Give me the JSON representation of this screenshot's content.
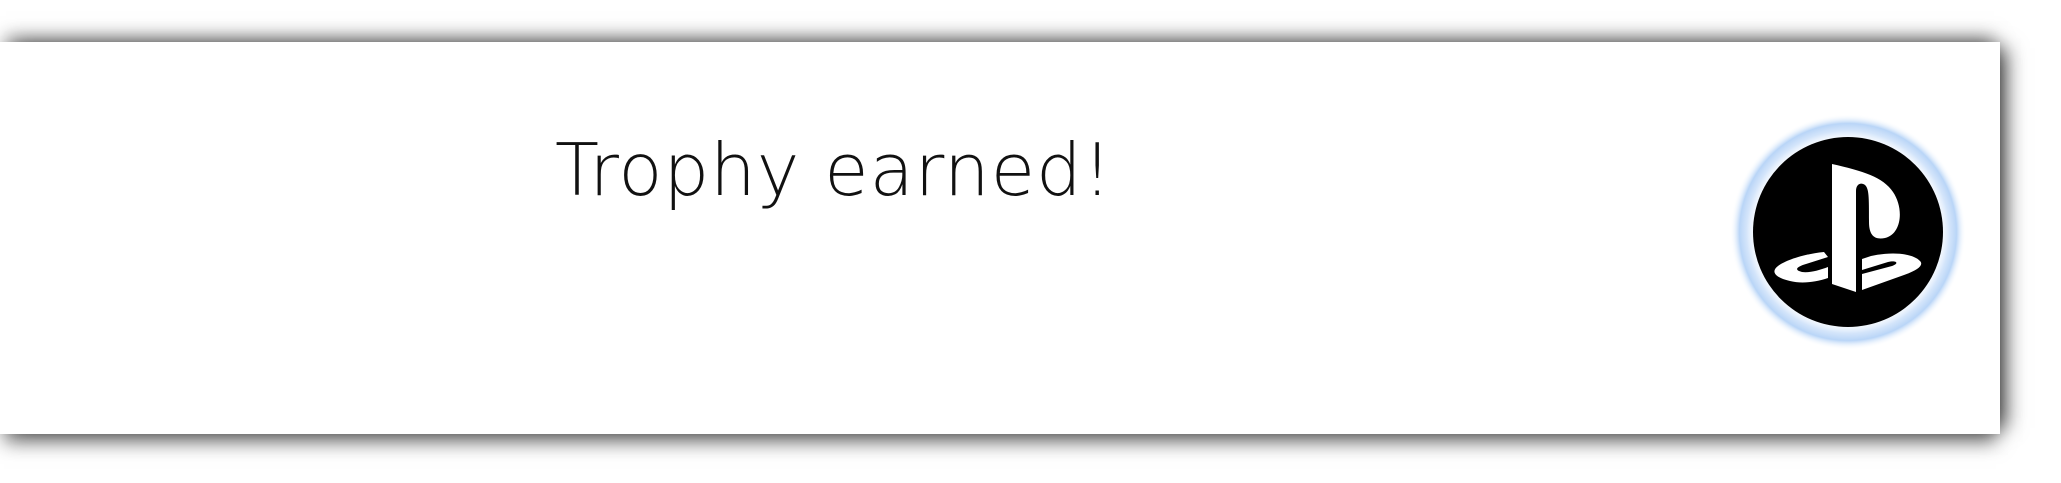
{
  "notification": {
    "message": "Trophy earned!",
    "icon": "playstation-logo-icon",
    "glow_color": "#bcd7f7",
    "badge_color": "#000000",
    "logo_color": "#ffffff"
  }
}
